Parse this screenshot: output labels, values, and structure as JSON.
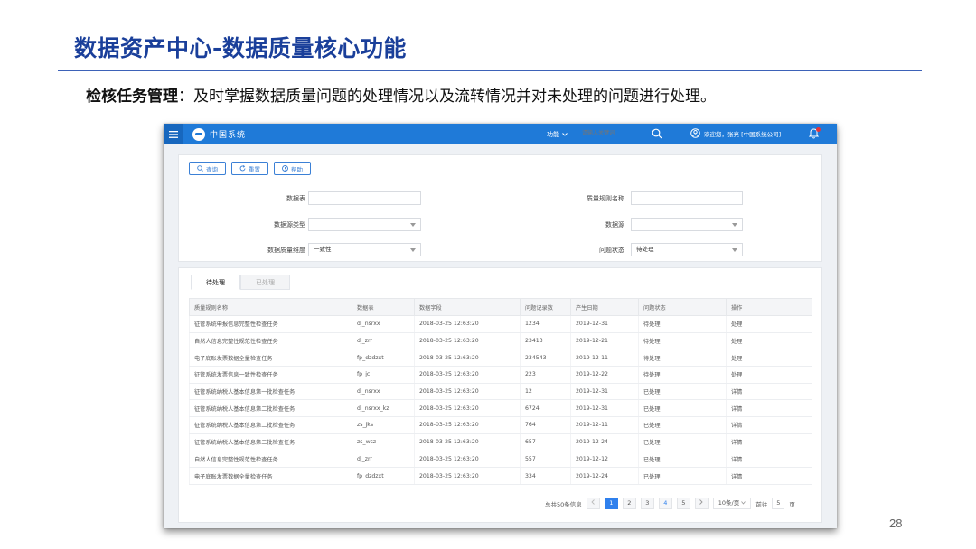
{
  "slide": {
    "title": "数据资产中心-数据质量核心功能",
    "subtitle_bold": "检核任务管理",
    "subtitle_rest": "：及时掌握数据质量问题的处理情况以及流转情况并对未处理的问题进行处理。",
    "page_number": "28"
  },
  "app": {
    "logo_text": "中国系统",
    "func_label": "功能",
    "search_placeholder": "请输入关键词",
    "user_text": "欢迎您，张亮 [中国系统公司]"
  },
  "toolbar": {
    "query_label": "查询",
    "reset_label": "重置",
    "help_label": "帮助"
  },
  "form": {
    "table_label": "数据表",
    "table_value": "",
    "rule_label": "质量规则名称",
    "rule_value": "",
    "source_type_label": "数据源类型",
    "source_type_value": "",
    "source_label": "数据源",
    "source_value": "",
    "dimension_label": "数据质量维度",
    "dimension_value": "一致性",
    "status_label": "问题状态",
    "status_value": "待处理"
  },
  "tabs": [
    {
      "label": "待处理",
      "active": true
    },
    {
      "label": "已处理",
      "active": false
    }
  ],
  "table": {
    "headers": [
      "质量规则名称",
      "数据表",
      "数据字段",
      "问题记录数",
      "产生日期",
      "问题状态",
      "操作"
    ],
    "rows": [
      [
        "征管系统申报信息完整性检查任务",
        "dj_nsrxx",
        "2018-03-25 12:63:20",
        "1234",
        "2019-12-31",
        "待处理",
        "处理"
      ],
      [
        "自然人信息完整性规范性检查任务",
        "dj_zrr",
        "2018-03-25 12:63:20",
        "23413",
        "2019-12-21",
        "待处理",
        "处理"
      ],
      [
        "电子底账发票数据全量检查任务",
        "fp_dzdzxt",
        "2018-03-25 12:63:20",
        "234543",
        "2019-12-11",
        "待处理",
        "处理"
      ],
      [
        "征管系统发票信息一致性检查任务",
        "fp_jc",
        "2018-03-25 12:63:20",
        "223",
        "2019-12-22",
        "待处理",
        "处理"
      ],
      [
        "征管系统纳税人基本信息第一批检查任务",
        "dj_nsrxx",
        "2018-03-25 12:63:20",
        "12",
        "2019-12-31",
        "已处理",
        "详情"
      ],
      [
        "征管系统纳税人基本信息第二批检查任务",
        "dj_nsrxx_kz",
        "2018-03-25 12:63:20",
        "6724",
        "2019-12-31",
        "已处理",
        "详情"
      ],
      [
        "征管系统纳税人基本信息第二批检查任务",
        "zs_jks",
        "2018-03-25 12:63:20",
        "764",
        "2019-12-11",
        "已处理",
        "详情"
      ],
      [
        "征管系统纳税人基本信息第二批检查任务",
        "zs_wsz",
        "2018-03-25 12:63:20",
        "657",
        "2019-12-24",
        "已处理",
        "详情"
      ],
      [
        "自然人信息完整性规范性检查任务",
        "dj_zrr",
        "2018-03-25 12:63:20",
        "557",
        "2019-12-12",
        "已处理",
        "详情"
      ],
      [
        "电子底账发票数据全量检查任务",
        "fp_dzdzxt",
        "2018-03-25 12:63:20",
        "334",
        "2019-12-24",
        "已处理",
        "详情"
      ]
    ]
  },
  "pager": {
    "total_text": "总共50条信息",
    "pages": [
      "1",
      "2",
      "3",
      "4",
      "5"
    ],
    "current": "1",
    "page_size": "10条/页",
    "jump_label": "前往",
    "jump_value": "5",
    "jump_suffix": "页"
  },
  "colors": {
    "title": "#1a3f9a",
    "topbar": "#1f7ad8",
    "link": "#2f7fd3"
  }
}
